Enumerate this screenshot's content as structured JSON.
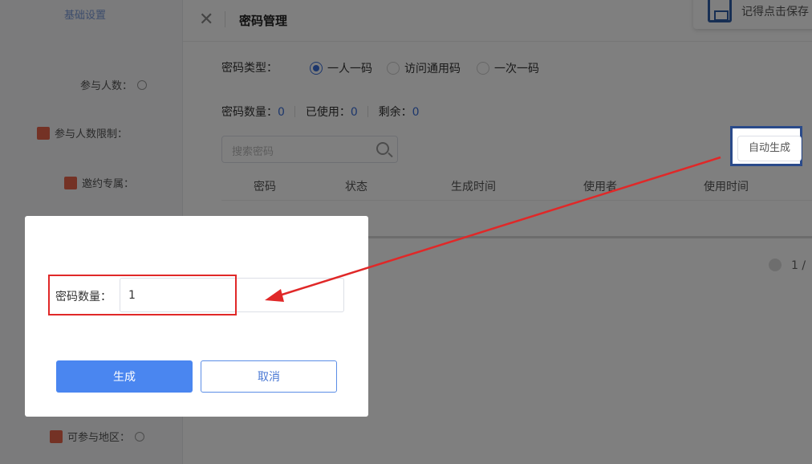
{
  "background": {
    "left_column": {
      "items": [
        "基础设置",
        "参与人数：",
        "参与人数限制：",
        "邀约专属：",
        "可参与地区："
      ]
    },
    "panel": {
      "title": "密码管理",
      "save_hint": "记得点击保存",
      "password_type_label": "密码类型：",
      "password_type_options": [
        "一人一码",
        "访问通用码",
        "一次一码"
      ],
      "selected_type": "一人一码",
      "stats": {
        "count_label": "密码数量：",
        "count_value": "0",
        "used_label": "已使用：",
        "used_value": "0",
        "remaining_label": "剩余：",
        "remaining_value": "0"
      },
      "search_placeholder": "搜索密码",
      "auto_generate_label": "自动生成",
      "table_headers": [
        "密码",
        "状态",
        "生成时间",
        "使用者",
        "使用时间"
      ],
      "pager_text": "1 /"
    }
  },
  "modal": {
    "field_label": "密码数量：",
    "field_value": "1",
    "generate_label": "生成",
    "cancel_label": "取消"
  },
  "annotations": {
    "highlight_color": "#e02828",
    "arrow_color": "#e02828",
    "focus_box_color": "#2a4a8a"
  }
}
